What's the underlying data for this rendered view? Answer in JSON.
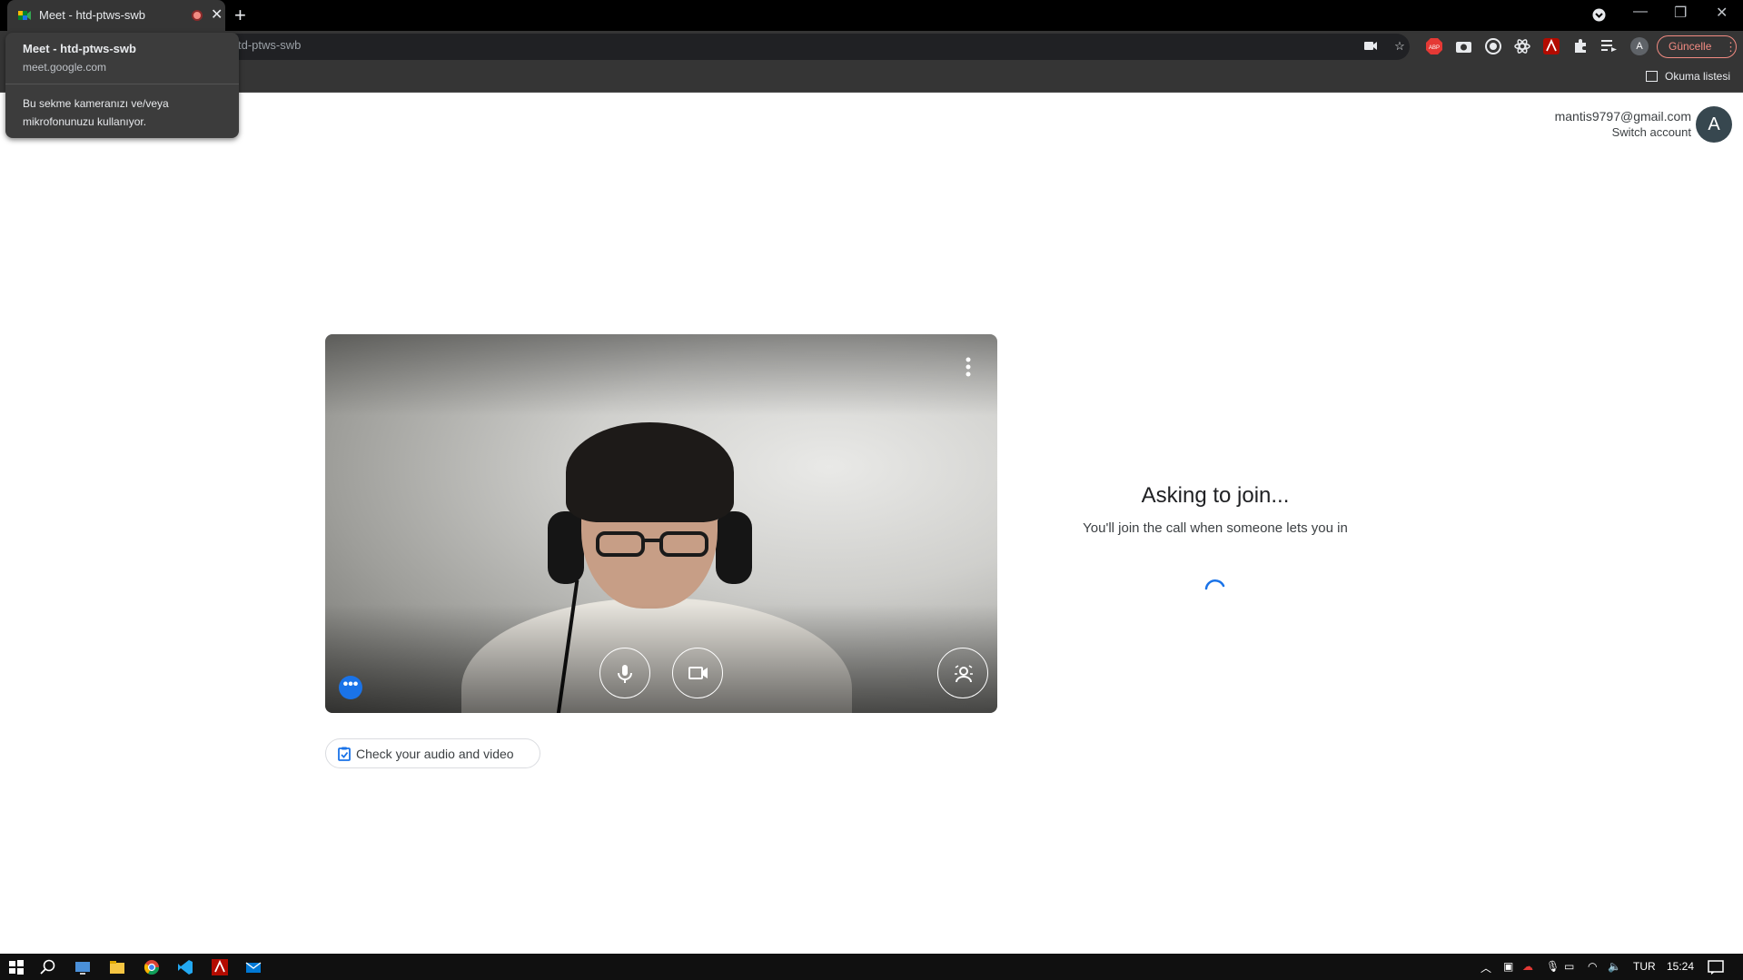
{
  "browser": {
    "tab_title": "Meet - htd-ptws-swb",
    "new_tab_symbol": "+",
    "url_text": "td-ptws-swb",
    "update_label": "Güncelle",
    "reading_list_label": "Okuma listesi",
    "profile_initial": "A"
  },
  "hover_card": {
    "title": "Meet - htd-ptws-swb",
    "domain": "meet.google.com",
    "notice": "Bu sekme kameranızı ve/veya mikrofonunuzu kullanıyor."
  },
  "account": {
    "email": "mantis9797@gmail.com",
    "switch_label": "Switch account",
    "avatar_initial": "A"
  },
  "preview": {
    "check_label": "Check your audio and video",
    "more_effects_symbol": "•••"
  },
  "join_status": {
    "heading": "Asking to join...",
    "subtext": "You'll join the call when someone lets you in"
  },
  "taskbar": {
    "language": "TUR",
    "time": "15:24"
  },
  "colors": {
    "accent": "#1a73e8",
    "chrome_dark": "#353535",
    "update_red": "#f28b82",
    "taskbar": "#101010"
  },
  "icons": [
    "windows-start-icon",
    "search-icon",
    "task-view-icon",
    "file-explorer-icon",
    "chrome-icon",
    "vscode-icon",
    "acrobat-icon",
    "mail-icon"
  ]
}
